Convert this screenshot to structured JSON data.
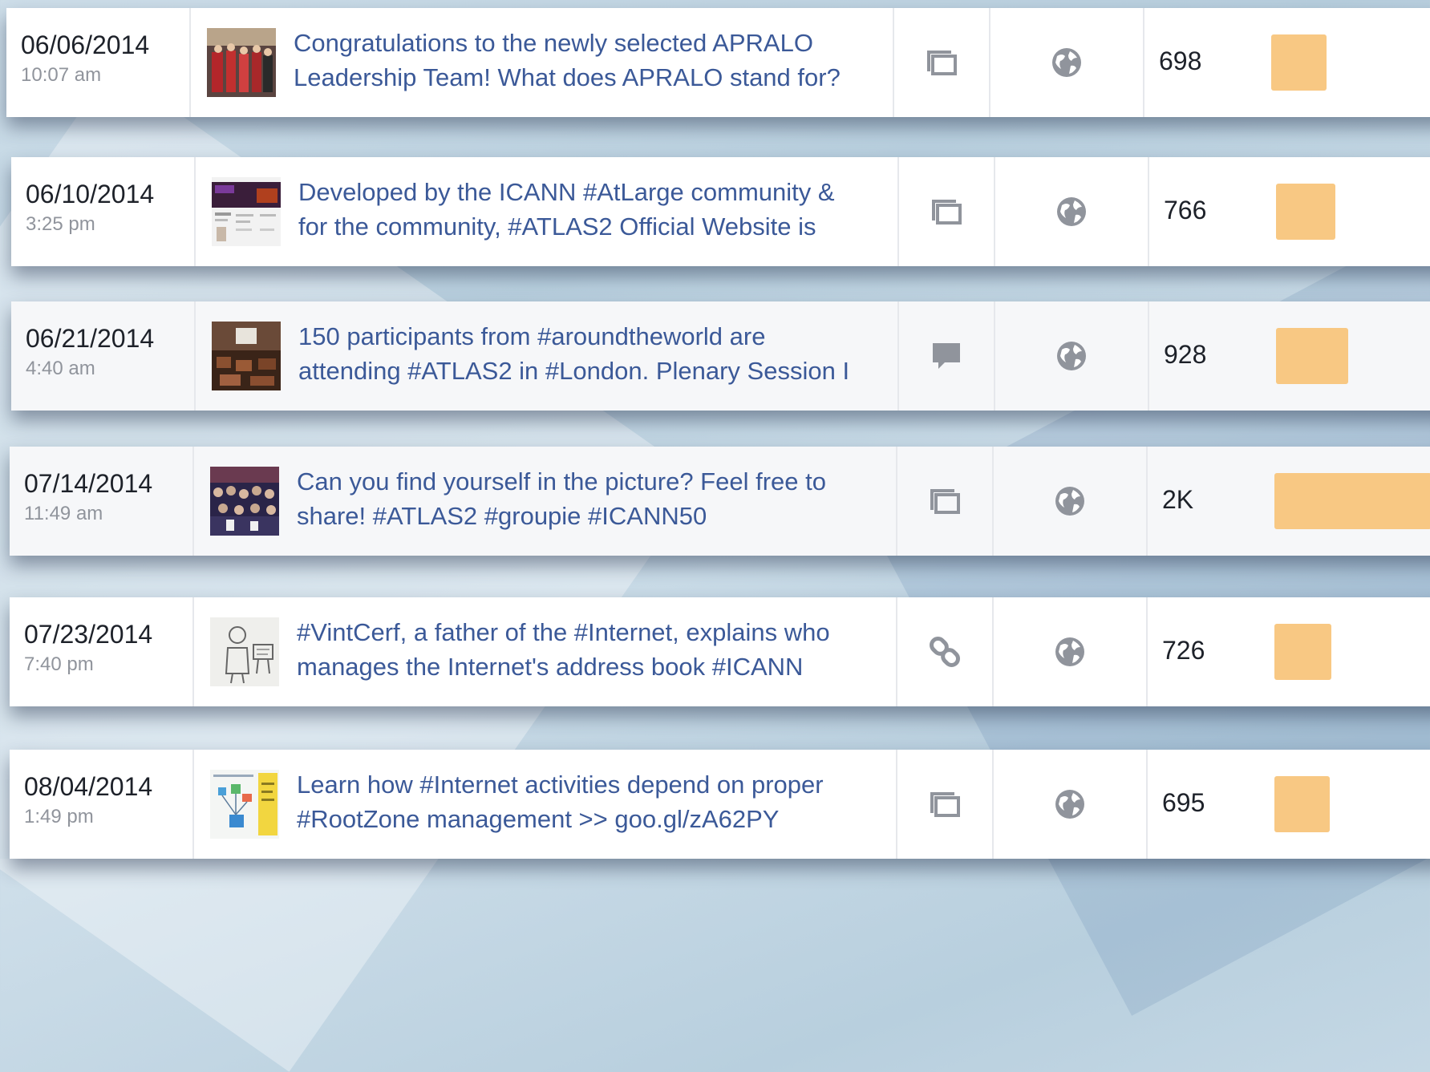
{
  "colors": {
    "reach_bar": "#f8c883",
    "post_link": "#3b5998",
    "icon_gray": "#90949c"
  },
  "posts": [
    {
      "date": "06/06/2014",
      "time": "10:07 am",
      "text_line1": "Congratulations to the newly selected APRALO",
      "text_line2": "Leadership Team! What does APRALO stand for?",
      "type_icon": "photo-album-icon",
      "targeting_icon": "globe-icon",
      "reach": "698",
      "reach_bar_fraction": 0.35
    },
    {
      "date": "06/10/2014",
      "time": "3:25 pm",
      "text_line1": "Developed by the ICANN #AtLarge community &",
      "text_line2": "for the community, #ATLAS2 Official Website is",
      "type_icon": "photo-album-icon",
      "targeting_icon": "globe-icon",
      "reach": "766",
      "reach_bar_fraction": 0.38
    },
    {
      "date": "06/21/2014",
      "time": "4:40 am",
      "text_line1": "150 participants from #aroundtheworld are",
      "text_line2": "attending #ATLAS2 in #London. Plenary Session I",
      "type_icon": "status-comment-icon",
      "targeting_icon": "globe-icon",
      "reach": "928",
      "reach_bar_fraction": 0.46
    },
    {
      "date": "07/14/2014",
      "time": "11:49 am",
      "text_line1": "Can you find yourself in the picture? Feel free to",
      "text_line2": "share! #ATLAS2 #groupie #ICANN50",
      "type_icon": "photo-album-icon",
      "targeting_icon": "globe-icon",
      "reach": "2K",
      "reach_bar_fraction": 1.0
    },
    {
      "date": "07/23/2014",
      "time": "7:40 pm",
      "text_line1": "#VintCerf, a father of the #Internet, explains who",
      "text_line2": "manages the Internet's address book #ICANN",
      "type_icon": "link-icon",
      "targeting_icon": "globe-icon",
      "reach": "726",
      "reach_bar_fraction": 0.36
    },
    {
      "date": "08/04/2014",
      "time": "1:49 pm",
      "text_line1": "Learn how #Internet activities depend on proper",
      "text_line2": "#RootZone management >> goo.gl/zA62PY",
      "type_icon": "photo-album-icon",
      "targeting_icon": "globe-icon",
      "reach": "695",
      "reach_bar_fraction": 0.35
    }
  ]
}
